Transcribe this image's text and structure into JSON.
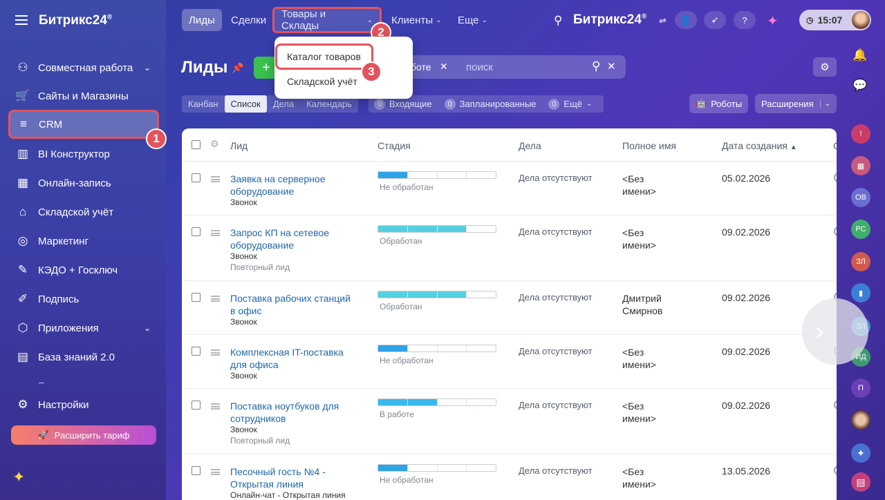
{
  "sidebar": {
    "logo": "Битрикс24",
    "logo_sup": "®",
    "items": [
      {
        "label": "Совместная работа",
        "icon": "team-icon",
        "chevron": true
      },
      {
        "label": "Сайты и Магазины",
        "icon": "cart-icon"
      },
      {
        "label": "CRM",
        "icon": "funnel-icon",
        "active": true
      },
      {
        "label": "BI Конструктор",
        "icon": "bar-chart-icon"
      },
      {
        "label": "Онлайн-запись",
        "icon": "calendar-icon"
      },
      {
        "label": "Складской учёт",
        "icon": "warehouse-icon"
      },
      {
        "label": "Маркетинг",
        "icon": "target-icon"
      },
      {
        "label": "КЭДО + Госключ",
        "icon": "doc-sign-icon"
      },
      {
        "label": "Подпись",
        "icon": "pen-icon"
      },
      {
        "label": "Приложения",
        "icon": "cube-icon",
        "chevron": true
      },
      {
        "label": "База знаний 2.0",
        "icon": "books-icon"
      }
    ],
    "divider": "–",
    "settings": "Настройки",
    "upgrade": "Расширить тариф",
    "badge": "1"
  },
  "topbar": {
    "tabs": [
      "Лиды",
      "Сделки",
      "Товары и Склады",
      "Клиенты",
      "Еще"
    ],
    "badge": "2",
    "brand": "Битрикс",
    "brand_num": "24",
    "brand_sup": "®",
    "time": "15:07"
  },
  "dropdown": {
    "items": [
      "Каталог товаров",
      "Складской учёт"
    ],
    "badge": "3"
  },
  "page": {
    "title": "Лиды",
    "add": "+",
    "filter_tag": "боте",
    "search_placeholder": "поиск",
    "views": [
      "Канбан",
      "Список",
      "Дела",
      "Календарь"
    ],
    "counters": [
      {
        "n": "0",
        "label": "Входящие"
      },
      {
        "n": "0",
        "label": "Запланированные"
      },
      {
        "n": "0",
        "label": "Ещё"
      }
    ],
    "robots": "Роботы",
    "extensions": "Расширения"
  },
  "table": {
    "headers": [
      "Лид",
      "Стадия",
      "Дела",
      "Полное имя",
      "Дата создания",
      "С"
    ],
    "rows": [
      {
        "name": "Заявка на серверное оборудование",
        "src": "Звонок",
        "src2": "",
        "stage": "Не обработан",
        "fill": 0.25,
        "color": "#2fa3e7",
        "deals": "Дела отсутствуют",
        "fullname": "<Без имени>",
        "date": "05.02.2026"
      },
      {
        "name": "Запрос КП на сетевое оборудование",
        "src": "Звонок",
        "src2": "Повторный лид",
        "stage": "Обработан",
        "fill": 0.75,
        "color": "#55d0e0",
        "deals": "Дела отсутствуют",
        "fullname": "<Без имени>",
        "date": "09.02.2026"
      },
      {
        "name": "Поставка рабочих станций в офис",
        "src": "Звонок",
        "src2": "",
        "stage": "Обработан",
        "fill": 0.75,
        "color": "#55d0e0",
        "deals": "Дела отсутствуют",
        "fullname": "Дмитрий Смирнов",
        "date": "09.02.2026"
      },
      {
        "name": "Комплексная IT-поставка для офиса",
        "src": "Звонок",
        "src2": "",
        "stage": "Не обработан",
        "fill": 0.25,
        "color": "#2fa3e7",
        "deals": "Дела отсутствуют",
        "fullname": "<Без имени>",
        "date": "09.02.2026"
      },
      {
        "name": "Поставка ноутбуков для сотрудников",
        "src": "Звонок",
        "src2": "Повторный лид",
        "stage": "В работе",
        "fill": 0.5,
        "color": "#39b9ee",
        "deals": "Дела отсутствуют",
        "fullname": "<Без имени>",
        "date": "09.02.2026"
      },
      {
        "name": "Песочный гость №4 - Открытая линия",
        "src": "Онлайн-чат - Открытая линия",
        "src2": "",
        "stage": "Не обработан",
        "fill": 0.25,
        "color": "#2fa3e7",
        "deals": "Дела отсутствуют",
        "fullname": "<Без имени>",
        "date": "13.05.2026"
      }
    ]
  },
  "rail": {
    "avatars": [
      "ОВ",
      "РС",
      "ЗЛ",
      "ЗЛ",
      "ИД",
      "П"
    ]
  }
}
